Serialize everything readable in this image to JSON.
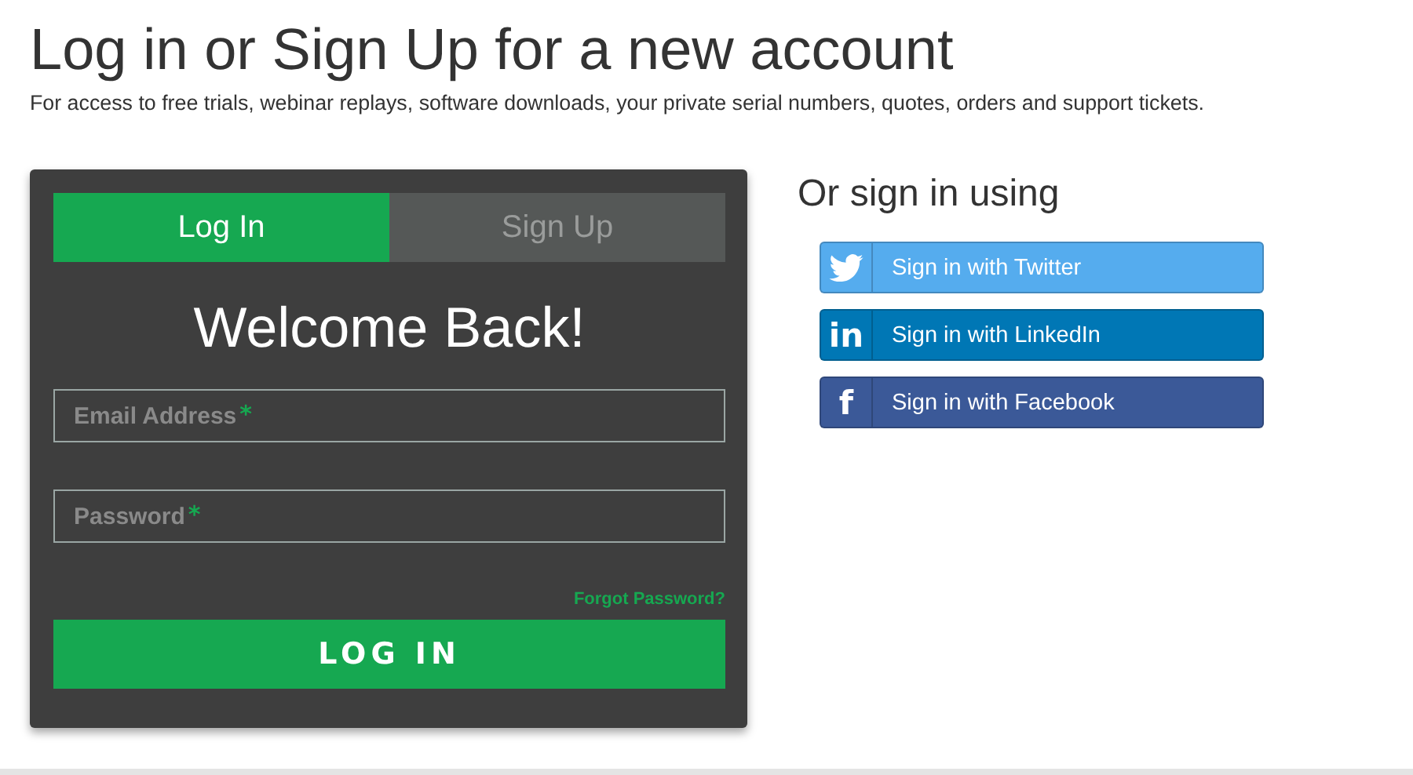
{
  "header": {
    "title": "Log in or Sign Up for a new account",
    "subtitle": "For access to free trials, webinar replays, software downloads, your private serial numbers, quotes, orders and support tickets."
  },
  "login_card": {
    "tabs": [
      {
        "label": "Log In",
        "selected": true
      },
      {
        "label": "Sign Up",
        "selected": false
      }
    ],
    "heading": "Welcome Back!",
    "fields": [
      {
        "label": "Email Address",
        "required_mark": "*"
      },
      {
        "label": "Password",
        "required_mark": "*"
      }
    ],
    "forgot_link": "Forgot Password?",
    "submit": "LOG IN"
  },
  "social": {
    "title": "Or sign in using",
    "buttons": [
      {
        "kind": "bird",
        "label": "Sign in with Twitter",
        "color": "#55acee"
      },
      {
        "kind": "glyph",
        "glyph": "in",
        "label": "Sign in with LinkedIn",
        "color": "#0077b5"
      },
      {
        "kind": "glyph",
        "glyph": "f",
        "label": "Sign in with Facebook",
        "color": "#3b5998"
      }
    ]
  }
}
